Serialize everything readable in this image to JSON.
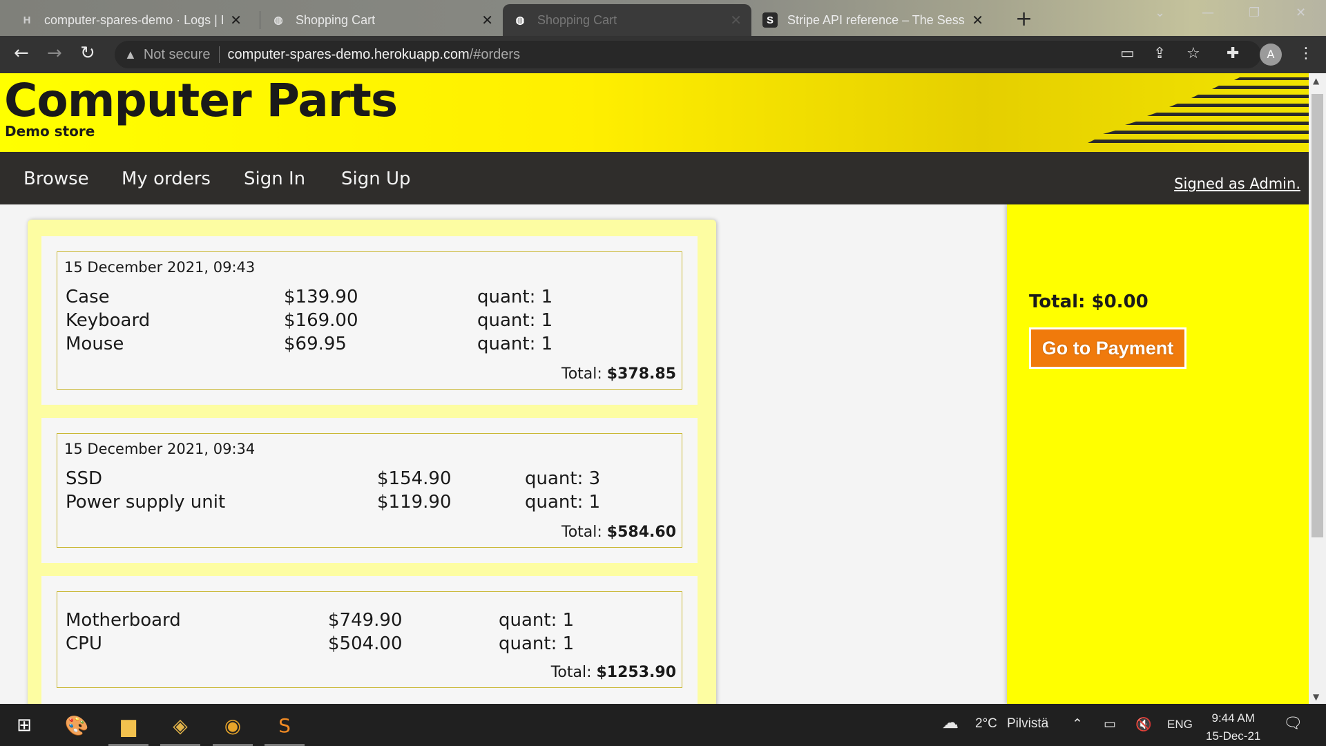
{
  "browser": {
    "tabs": [
      {
        "title": "computer-spares-demo · Logs | H",
        "favicon": "heroku-icon",
        "active": false
      },
      {
        "title": "Shopping Cart",
        "favicon": "globe-icon",
        "active": false
      },
      {
        "title": "Shopping Cart",
        "favicon": "globe-icon",
        "active": true
      },
      {
        "title": "Stripe API reference – The Sessio",
        "favicon": "stripe-icon",
        "active": false
      }
    ],
    "security_label": "Not secure",
    "url_host": "computer-spares-demo.herokuapp.com",
    "url_path": "/#orders",
    "profile_initial": "A"
  },
  "site": {
    "logo": "Computer Parts",
    "subtitle": "Demo store",
    "nav": [
      "Browse",
      "My orders",
      "Sign In",
      "Sign Up"
    ],
    "signed_as": "Signed as Admin."
  },
  "orders": [
    {
      "date": "15 December 2021, 09:43",
      "items": [
        {
          "name": "Case",
          "price": "$139.90",
          "quant": "quant: 1"
        },
        {
          "name": "Keyboard",
          "price": "$169.00",
          "quant": "quant: 1"
        },
        {
          "name": "Mouse",
          "price": "$69.95",
          "quant": "quant: 1"
        }
      ],
      "total_label": "Total:",
      "total": "$378.85"
    },
    {
      "date": "15 December 2021, 09:34",
      "items": [
        {
          "name": "SSD",
          "price": "$154.90",
          "quant": "quant: 3"
        },
        {
          "name": "Power supply unit",
          "price": "$119.90",
          "quant": "quant: 1"
        }
      ],
      "total_label": "Total:",
      "total": "$584.60"
    },
    {
      "date": "",
      "items": [
        {
          "name": "Motherboard",
          "price": "$749.90",
          "quant": "quant: 1"
        },
        {
          "name": "CPU",
          "price": "$504.00",
          "quant": "quant: 1"
        }
      ],
      "total_label": "Total:",
      "total": "$1253.90"
    }
  ],
  "cart": {
    "total": "Total: $0.00",
    "pay_button": "Go to Payment"
  },
  "taskbar": {
    "weather": "2°C",
    "weather_desc": "Pilvistä",
    "language": "ENG",
    "time": "9:44 AM",
    "date": "15-Dec-21"
  },
  "colors": {
    "brand_yellow": "#ffff00",
    "nav_dark": "#2f2d2b",
    "pay_orange": "#f07a0c",
    "order_border": "#c9b733"
  }
}
